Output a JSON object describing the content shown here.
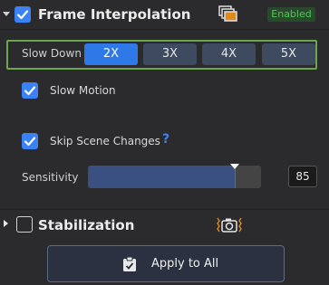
{
  "frame_interpolation": {
    "title": "Frame Interpolation",
    "status": "Enabled",
    "checked": true,
    "slow_down": {
      "label": "Slow Down",
      "options": [
        "2X",
        "3X",
        "4X",
        "5X"
      ],
      "selected": "2X"
    },
    "slow_motion": {
      "label": "Slow Motion",
      "checked": true
    },
    "skip_scene_changes": {
      "label": "Skip Scene Changes",
      "checked": true,
      "help": "?"
    },
    "sensitivity": {
      "label": "Sensitivity",
      "value": "85",
      "level": 0.85
    }
  },
  "stabilization": {
    "title": "Stabilization",
    "checked": false
  },
  "apply_all": {
    "label": "Apply to All"
  },
  "colors": {
    "accent": "#3b82f6",
    "enabled": "#4ecb55",
    "frame": "#6aa84f"
  },
  "icons": [
    "caret-down-icon",
    "checkbox-icon",
    "frames-icon",
    "help-icon",
    "caret-right-icon",
    "camera-shake-icon",
    "clipboard-icon"
  ]
}
